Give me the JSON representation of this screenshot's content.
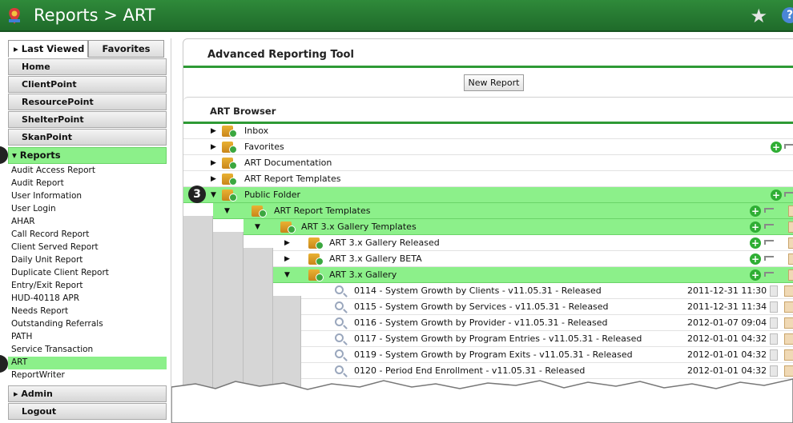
{
  "topbar": {
    "title": "Reports > ART"
  },
  "sidebar": {
    "tabs": {
      "last_viewed": "Last Viewed",
      "favorites": "Favorites"
    },
    "nav": [
      "Home",
      "ClientPoint",
      "ResourcePoint",
      "ShelterPoint",
      "SkanPoint"
    ],
    "reports_section": "Reports",
    "report_items": [
      "Audit Access Report",
      "Audit Report",
      "User Information",
      "User Login",
      "AHAR",
      "Call Record Report",
      "Client Served Report",
      "Daily Unit Report",
      "Duplicate Client Report",
      "Entry/Exit Report",
      "HUD-40118 APR",
      "Needs Report",
      "Outstanding Referrals",
      "PATH",
      "Service Transaction",
      "ART",
      "ReportWriter"
    ],
    "selected_item": "ART",
    "admin": "Admin",
    "logout": "Logout"
  },
  "main": {
    "title": "Advanced Reporting Tool",
    "new_report": "New Report",
    "browser_title": "ART Browser",
    "folders": [
      "Inbox",
      "Favorites",
      "ART Documentation",
      "ART Report Templates",
      "Public Folder"
    ],
    "public_children": {
      "templates": "ART Report Templates",
      "gallery_templates": "ART 3.x Gallery Templates",
      "gallery_items": [
        "ART 3.x Gallery Released",
        "ART 3.x Gallery BETA",
        "ART 3.x Gallery"
      ]
    },
    "reports": [
      {
        "name": "0114 - System Growth by Clients - v11.05.31 - Released",
        "date": "2011-12-31 11:30"
      },
      {
        "name": "0115 - System Growth by Services - v11.05.31 - Released",
        "date": "2011-12-31 11:34"
      },
      {
        "name": "0116 - System Growth by Provider - v11.05.31 - Released",
        "date": "2012-01-07 09:04"
      },
      {
        "name": "0117 - System Growth by Program Entries - v11.05.31 - Released",
        "date": "2012-01-01 04:32"
      },
      {
        "name": "0119 - System Growth by Program Exits - v11.05.31 - Released",
        "date": "2012-01-01 04:32"
      },
      {
        "name": "0120 - Period End Enrollment - v11.05.31 - Released",
        "date": "2012-01-01 04:32"
      }
    ]
  },
  "callouts": {
    "public_folder": "3"
  },
  "colors": {
    "accent_green": "#8cf08a",
    "bar_green": "#2e9a35"
  }
}
